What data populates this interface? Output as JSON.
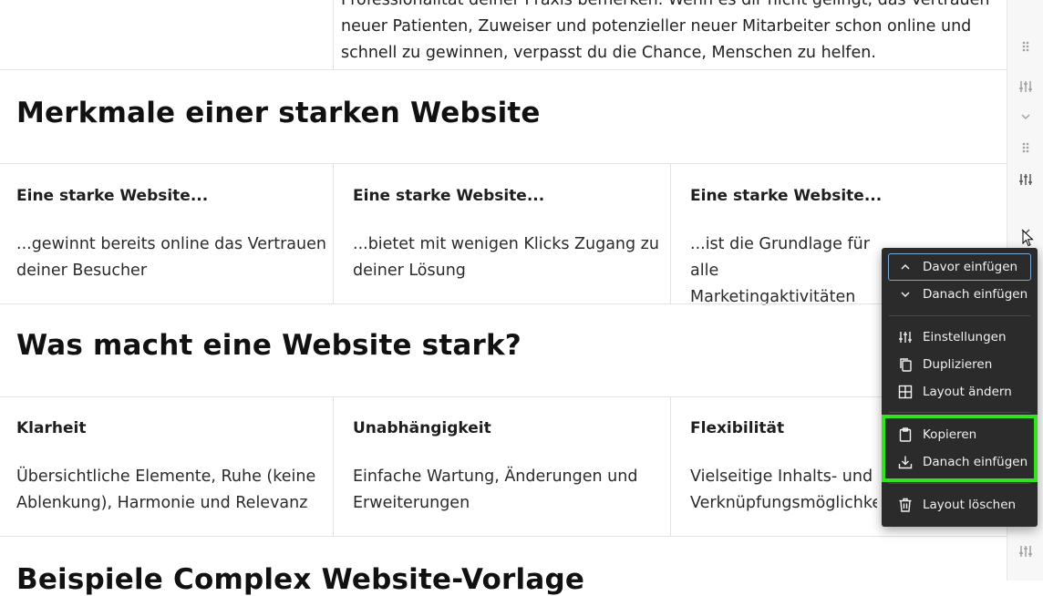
{
  "intro": {
    "text": "Professionalität deiner Praxis bemerken. Wenn es dir nicht gelingt, das Vertrauen neuer Patienten, Zuweiser und potenzieller neuer Mitarbeiter schon online und schnell zu gewinnen, verpasst du die Chance, Menschen zu helfen."
  },
  "section1": {
    "heading": "Merkmale einer starken Website",
    "columns": [
      {
        "title": "Eine starke Website...",
        "text": "...gewinnt bereits online das Vertrauen deiner Besucher"
      },
      {
        "title": "Eine starke Website...",
        "text": "...bietet mit wenigen Klicks Zugang zu deiner Lösung"
      },
      {
        "title": "Eine starke Website...",
        "text": "...ist die Grundlage für alle Marketingaktivitäten"
      }
    ]
  },
  "section2": {
    "heading": "Was macht eine Website stark?",
    "columns": [
      {
        "title": "Klarheit",
        "text": "Übersichtliche Elemente, Ruhe (keine Ablenkung), Harmonie und Relevanz"
      },
      {
        "title": "Unabhängigkeit",
        "text": "Einfache Wartung, Änderungen und Erweiterungen"
      },
      {
        "title": "Flexibilität",
        "text": "Vielseitige Inhalts- und Verknüpfungsmöglichkeiten"
      }
    ]
  },
  "section3": {
    "heading": "Beispiele Complex Website-Vorlage"
  },
  "context_menu": {
    "insert_before": "Davor einfügen",
    "insert_after": "Danach einfügen",
    "settings": "Einstellungen",
    "duplicate": "Duplizieren",
    "change_layout": "Layout ändern",
    "copy": "Kopieren",
    "paste_after": "Danach einfügen",
    "delete_layout": "Layout löschen"
  },
  "colors": {
    "menu_bg": "#2b2b2b",
    "highlight": "#2fe41d",
    "focus": "#7aa7d6"
  }
}
